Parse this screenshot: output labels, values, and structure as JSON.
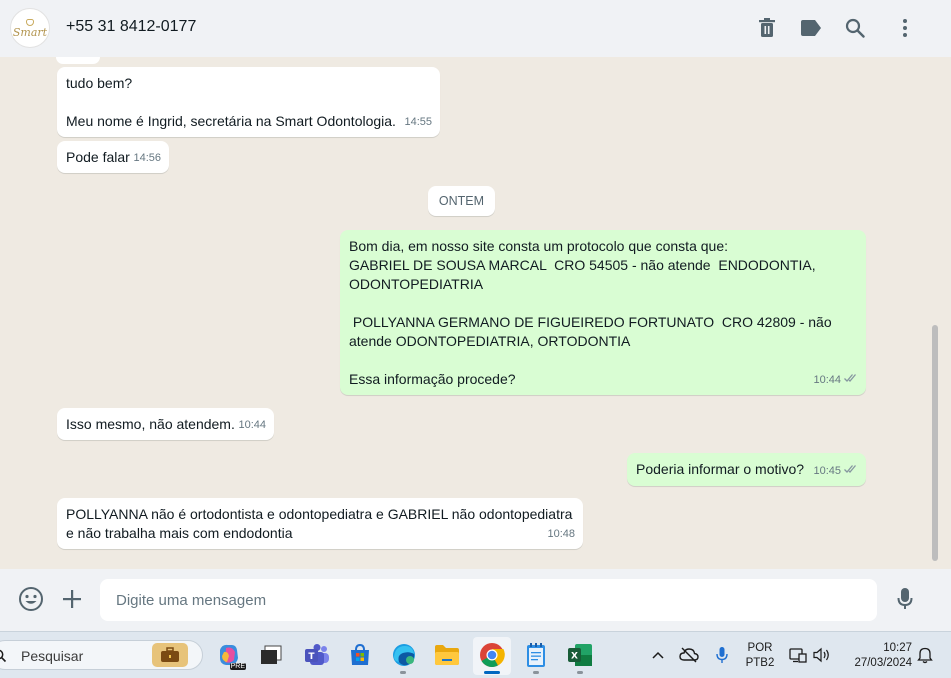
{
  "header": {
    "avatar_text": "Smart",
    "contact_name": "+55 31 8412-0177",
    "icons": [
      "trash-icon",
      "label-icon",
      "search-icon",
      "menu-icon"
    ]
  },
  "date_chip": "ONTEM",
  "messages": [
    {
      "direction": "in",
      "text": "tudo bem?\n\nMeu nome é Ingrid, secretária na Smart Odontologia.",
      "time": "14:55"
    },
    {
      "direction": "in",
      "text": "Pode falar",
      "time": "14:56"
    },
    {
      "direction": "out",
      "text": "Bom dia, em nosso site consta um protocolo que consta que:\nGABRIEL DE SOUSA MARCAL  CRO 54505 - não atende  ENDODONTIA, ODONTOPEDIATRIA\n\n POLLYANNA GERMANO DE FIGUEIREDO FORTUNATO  CRO 42809 - não atende ODONTOPEDIATRIA, ORTODONTIA\n\nEssa informação procede?",
      "time": "10:44"
    },
    {
      "direction": "in",
      "text": "Isso mesmo, não atendem.",
      "time": "10:44"
    },
    {
      "direction": "out",
      "text": "Poderia informar o motivo?",
      "time": "10:45"
    },
    {
      "direction": "in",
      "text": "POLLYANNA não é ortodontista e odontopediatra e GABRIEL não odontopediatra\ne não trabalha mais com endodontia",
      "time": "10:48"
    }
  ],
  "composer": {
    "placeholder": "Digite uma mensagem"
  },
  "taskbar": {
    "search_placeholder": "Pesquisar",
    "lang_top": "POR",
    "lang_bottom": "PTB2",
    "clock_time": "10:27",
    "clock_date": "27/03/2024",
    "copilot_badge": "PRE"
  },
  "colors": {
    "incoming": "#ffffff",
    "outgoing": "#d9fdd3",
    "chat_bg": "#efeae2",
    "header_bg": "#f0f2f5"
  }
}
